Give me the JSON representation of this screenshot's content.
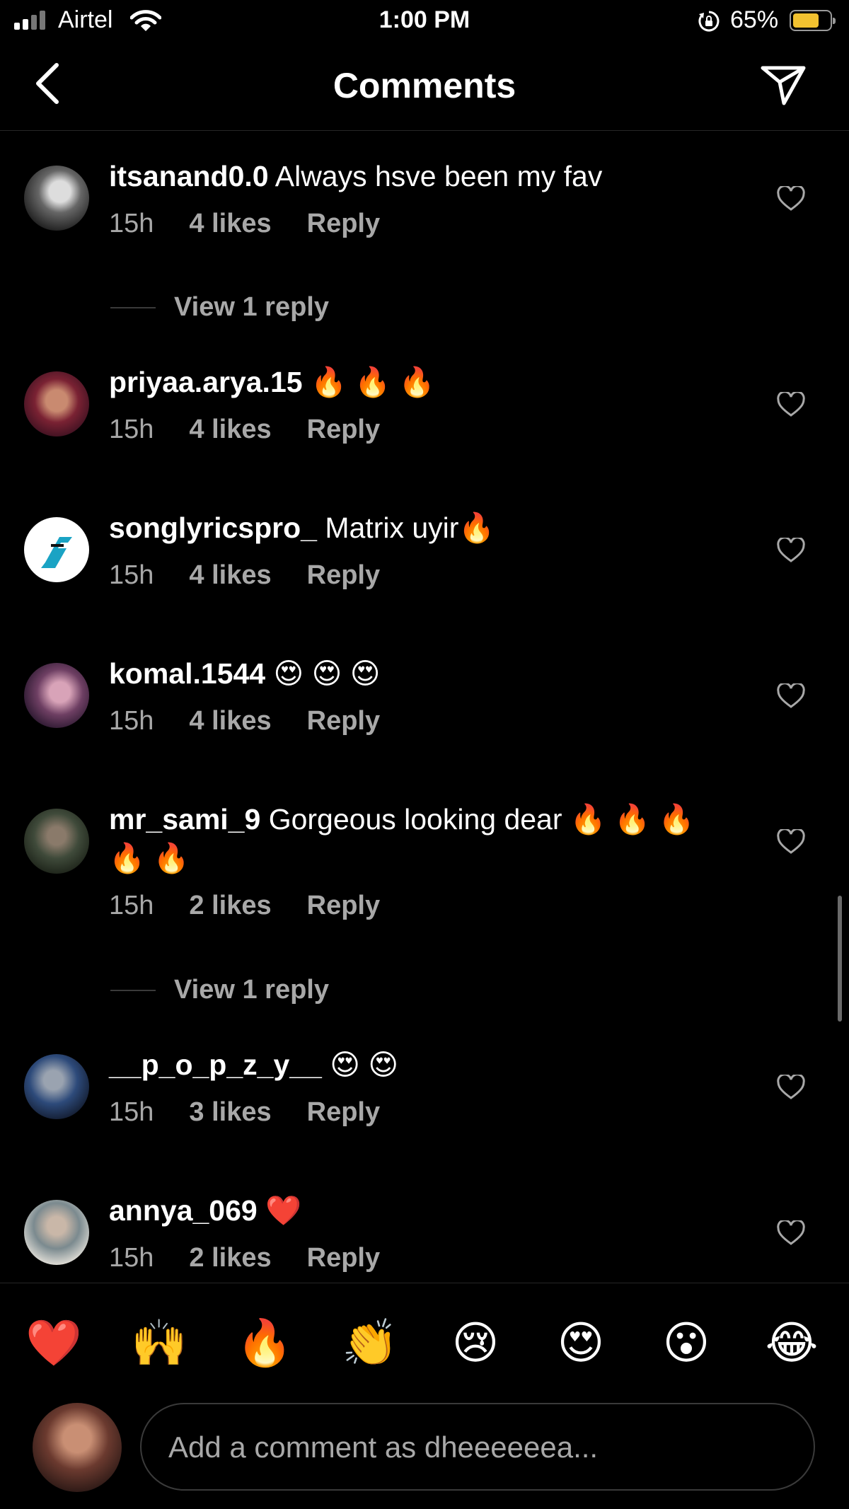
{
  "status_bar": {
    "carrier": "Airtel",
    "time": "1:00 PM",
    "battery": "65%",
    "battery_level": 0.65
  },
  "header": {
    "title": "Comments"
  },
  "comments": [
    {
      "user": "itsanand0.0",
      "text": "Always hsve been my fav",
      "time": "15h",
      "likes": "4 likes",
      "reply": "Reply",
      "view_reply": "View 1 reply"
    },
    {
      "user": "priyaa.arya.15",
      "text": "🔥 🔥 🔥",
      "time": "15h",
      "likes": "4 likes",
      "reply": "Reply"
    },
    {
      "user": "songlyricspro_",
      "text": "Matrix uyir🔥",
      "time": "15h",
      "likes": "4 likes",
      "reply": "Reply"
    },
    {
      "user": "komal.1544",
      "text": "😍 😍 😍",
      "time": "15h",
      "likes": "4 likes",
      "reply": "Reply"
    },
    {
      "user": "mr_sami_9",
      "text": "Gorgeous looking dear 🔥 🔥 🔥 🔥 🔥",
      "time": "15h",
      "likes": "2 likes",
      "reply": "Reply",
      "view_reply": "View 1 reply"
    },
    {
      "user": "__p_o_p_z_y__",
      "text": "😍 😍",
      "time": "15h",
      "likes": "3 likes",
      "reply": "Reply"
    },
    {
      "user": "annya_069",
      "text": "❤️",
      "time": "15h",
      "likes": "2 likes",
      "reply": "Reply"
    }
  ],
  "emoji_bar": [
    "❤️",
    "🙌",
    "🔥",
    "👏",
    "😢",
    "😍",
    "😮",
    "😂"
  ],
  "composer": {
    "placeholder": "Add a comment as dheeeeeea..."
  },
  "colors": {
    "background": "#000000",
    "muted_text": "#a8a8a8",
    "battery": "#f2c230"
  }
}
